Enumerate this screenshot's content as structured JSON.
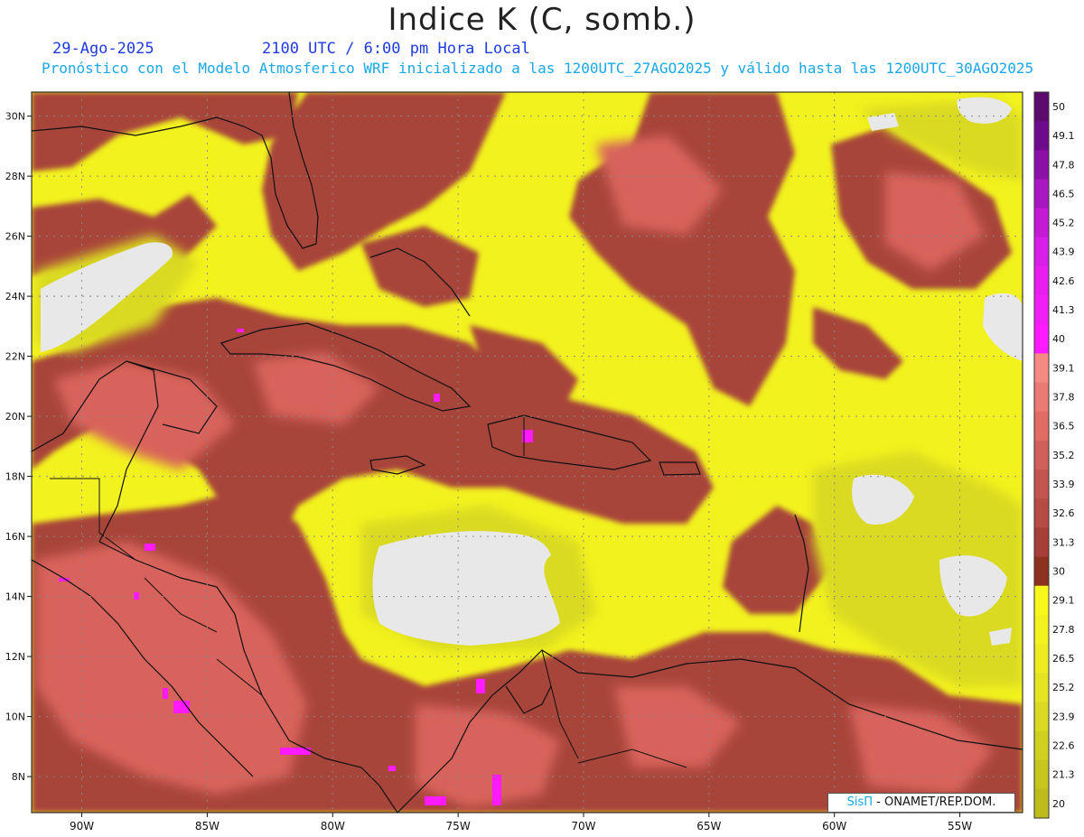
{
  "header": {
    "title": "Indice K (C, somb.)",
    "date": "29-Ago-2025",
    "time": "2100 UTC / 6:00 pm Hora Local",
    "subtitle": "Pronóstico con el Modelo Atmosferico WRF inicializado a las 1200UTC_27AGO2025 y válido hasta las  1200UTC_30AGO2025"
  },
  "map": {
    "lon_range": [
      -92,
      -52.5
    ],
    "lat_range": [
      6.8,
      30.8
    ],
    "lon_ticks": [
      "90W",
      "85W",
      "80W",
      "75W",
      "70W",
      "65W",
      "60W",
      "55W"
    ],
    "lon_values": [
      -90,
      -85,
      -80,
      -75,
      -70,
      -65,
      -60,
      -55
    ],
    "lat_ticks": [
      "30N",
      "28N",
      "26N",
      "24N",
      "22N",
      "20N",
      "18N",
      "16N",
      "14N",
      "12N",
      "10N",
      "8N"
    ],
    "lat_values": [
      30,
      28,
      26,
      24,
      22,
      20,
      18,
      16,
      14,
      12,
      10,
      8
    ],
    "grid": true
  },
  "legend": {
    "levels": [
      "50",
      "49.1",
      "47.8",
      "46.5",
      "45.2",
      "43.9",
      "42.6",
      "41.3",
      "40",
      "39.1",
      "37.8",
      "36.5",
      "35.2",
      "33.9",
      "32.6",
      "31.3",
      "30",
      "29.1",
      "27.8",
      "26.5",
      "25.2",
      "23.9",
      "22.6",
      "21.3",
      "20"
    ],
    "colors": [
      "#5c0a6e",
      "#6e0a8c",
      "#8a10a8",
      "#a818c2",
      "#c41ad6",
      "#d81ee8",
      "#e81ef0",
      "#f21ef6",
      "#ff1aff",
      "#f48a82",
      "#ea7a72",
      "#e06c64",
      "#d2605a",
      "#c45450",
      "#b64a44",
      "#a83e38",
      "#8e3220",
      "#f8f81c",
      "#f2f21e",
      "#ecec20",
      "#e4e422",
      "#dada22",
      "#d0d020",
      "#c6c61e",
      "#bcbc1c"
    ]
  },
  "credit": {
    "sis": "SisΠ",
    "rest": "- ONAMET/REP.DOM."
  }
}
